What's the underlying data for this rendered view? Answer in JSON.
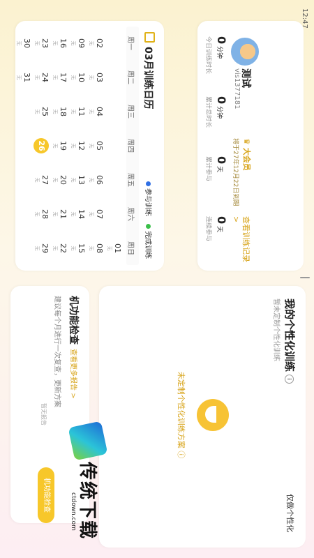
{
  "status_bar": {
    "time": "12:47"
  },
  "profile": {
    "name": "测试",
    "user_id": "vis1377181",
    "vip_label": "大会员",
    "vip_expiry": "将于27年12月22日到期",
    "record_link": "查看训练记录 >",
    "stats": [
      {
        "value": "0",
        "unit": "分钟",
        "label": "今日训练时长"
      },
      {
        "value": "0",
        "unit": "分钟",
        "label": "累计总时长"
      },
      {
        "value": "0",
        "unit": "天",
        "label": "累计参与"
      },
      {
        "value": "0",
        "unit": "天",
        "label": "连续参与"
      }
    ]
  },
  "calendar": {
    "title": "03月训练日历",
    "legend": [
      {
        "label": "参与训练",
        "color": "#2f6fe4"
      },
      {
        "label": "完成训练",
        "color": "#3bbf4a"
      }
    ],
    "weekdays": [
      "周一",
      "周二",
      "周三",
      "周四",
      "周五",
      "周六",
      "周日"
    ],
    "no_record": "无",
    "today": "26",
    "weeks": [
      [
        "",
        "",
        "",
        "",
        "",
        "",
        "01"
      ],
      [
        "02",
        "03",
        "04",
        "05",
        "06",
        "07",
        "08"
      ],
      [
        "09",
        "10",
        "11",
        "12",
        "13",
        "14",
        "15"
      ],
      [
        "16",
        "17",
        "18",
        "19",
        "20",
        "21",
        "22"
      ],
      [
        "23",
        "24",
        "25",
        "26",
        "27",
        "28",
        "29"
      ],
      [
        "30",
        "31",
        "",
        "",
        "",
        "",
        ""
      ]
    ]
  },
  "personal": {
    "title": "我的个性化训练",
    "subtitle": "暂未定制个性化训练",
    "right_label": "仅做个性化",
    "link": "未定制个性化训练方案"
  },
  "check": {
    "title": "机功能检查",
    "link": "查看更多报告 >",
    "desc": "建议每个月进行一次复查，更新方案",
    "no_report": "暂无报告",
    "button": "机功能检查"
  },
  "watermark": {
    "brand": "传统下载",
    "url": "ctdown.com"
  }
}
